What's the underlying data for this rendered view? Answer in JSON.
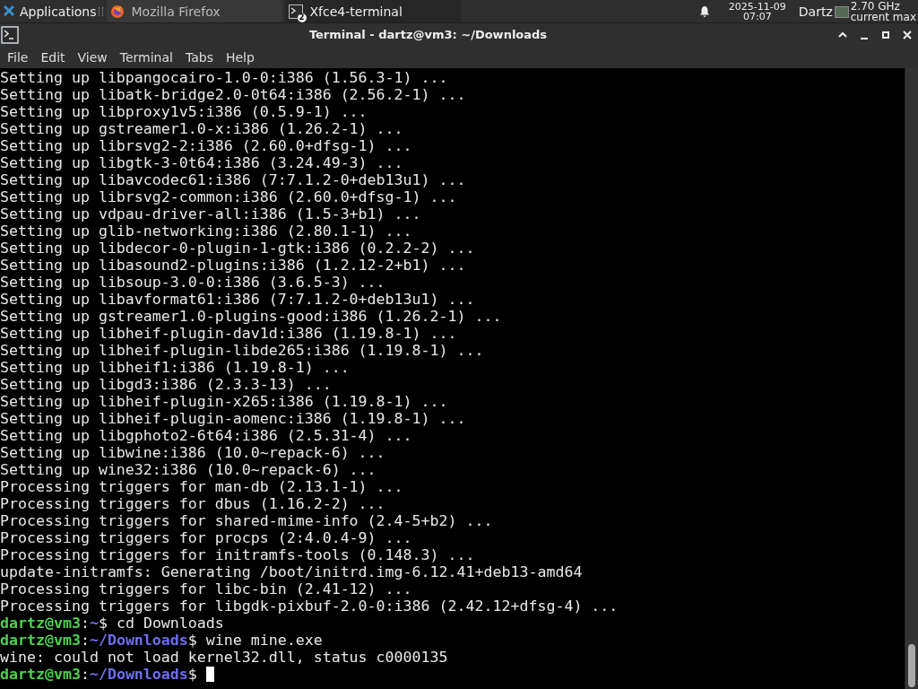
{
  "panel": {
    "applications_label": "Applications",
    "tasks": [
      {
        "label": "Mozilla Firefox",
        "kind": "browser",
        "selected": false
      },
      {
        "label": "Xfce4-terminal",
        "kind": "terminal",
        "badge": "2",
        "selected": true
      }
    ],
    "date": "2025-11-09",
    "time": "07:07",
    "user": "Dartz",
    "cpu_lines": [
      "2.70 GHz",
      "current max"
    ]
  },
  "window": {
    "title": "Terminal - dartz@vm3: ~/Downloads"
  },
  "menu": [
    "File",
    "Edit",
    "View",
    "Terminal",
    "Tabs",
    "Help"
  ],
  "terminal": {
    "lines": [
      {
        "kind": "output",
        "text": "Setting up libpangocairo-1.0-0:i386 (1.56.3-1) ..."
      },
      {
        "kind": "output",
        "text": "Setting up libatk-bridge2.0-0t64:i386 (2.56.2-1) ..."
      },
      {
        "kind": "output",
        "text": "Setting up libproxy1v5:i386 (0.5.9-1) ..."
      },
      {
        "kind": "output",
        "text": "Setting up gstreamer1.0-x:i386 (1.26.2-1) ..."
      },
      {
        "kind": "output",
        "text": "Setting up librsvg2-2:i386 (2.60.0+dfsg-1) ..."
      },
      {
        "kind": "output",
        "text": "Setting up libgtk-3-0t64:i386 (3.24.49-3) ..."
      },
      {
        "kind": "output",
        "text": "Setting up libavcodec61:i386 (7:7.1.2-0+deb13u1) ..."
      },
      {
        "kind": "output",
        "text": "Setting up librsvg2-common:i386 (2.60.0+dfsg-1) ..."
      },
      {
        "kind": "output",
        "text": "Setting up vdpau-driver-all:i386 (1.5-3+b1) ..."
      },
      {
        "kind": "output",
        "text": "Setting up glib-networking:i386 (2.80.1-1) ..."
      },
      {
        "kind": "output",
        "text": "Setting up libdecor-0-plugin-1-gtk:i386 (0.2.2-2) ..."
      },
      {
        "kind": "output",
        "text": "Setting up libasound2-plugins:i386 (1.2.12-2+b1) ..."
      },
      {
        "kind": "output",
        "text": "Setting up libsoup-3.0-0:i386 (3.6.5-3) ..."
      },
      {
        "kind": "output",
        "text": "Setting up libavformat61:i386 (7:7.1.2-0+deb13u1) ..."
      },
      {
        "kind": "output",
        "text": "Setting up gstreamer1.0-plugins-good:i386 (1.26.2-1) ..."
      },
      {
        "kind": "output",
        "text": "Setting up libheif-plugin-dav1d:i386 (1.19.8-1) ..."
      },
      {
        "kind": "output",
        "text": "Setting up libheif-plugin-libde265:i386 (1.19.8-1) ..."
      },
      {
        "kind": "output",
        "text": "Setting up libheif1:i386 (1.19.8-1) ..."
      },
      {
        "kind": "output",
        "text": "Setting up libgd3:i386 (2.3.3-13) ..."
      },
      {
        "kind": "output",
        "text": "Setting up libheif-plugin-x265:i386 (1.19.8-1) ..."
      },
      {
        "kind": "output",
        "text": "Setting up libheif-plugin-aomenc:i386 (1.19.8-1) ..."
      },
      {
        "kind": "output",
        "text": "Setting up libgphoto2-6t64:i386 (2.5.31-4) ..."
      },
      {
        "kind": "output",
        "text": "Setting up libwine:i386 (10.0~repack-6) ..."
      },
      {
        "kind": "output",
        "text": "Setting up wine32:i386 (10.0~repack-6) ..."
      },
      {
        "kind": "output",
        "text": "Processing triggers for man-db (2.13.1-1) ..."
      },
      {
        "kind": "output",
        "text": "Processing triggers for dbus (1.16.2-2) ..."
      },
      {
        "kind": "output",
        "text": "Processing triggers for shared-mime-info (2.4-5+b2) ..."
      },
      {
        "kind": "output",
        "text": "Processing triggers for procps (2:4.0.4-9) ..."
      },
      {
        "kind": "output",
        "text": "Processing triggers for initramfs-tools (0.148.3) ..."
      },
      {
        "kind": "output",
        "text": "update-initramfs: Generating /boot/initrd.img-6.12.41+deb13-amd64"
      },
      {
        "kind": "output",
        "text": "Processing triggers for libc-bin (2.41-12) ..."
      },
      {
        "kind": "output",
        "text": "Processing triggers for libgdk-pixbuf-2.0-0:i386 (2.42.12+dfsg-4) ..."
      },
      {
        "kind": "prompt",
        "user": "dartz@vm3",
        "sep": ":",
        "path": "~",
        "sign": "$",
        "command": "cd Downloads"
      },
      {
        "kind": "prompt",
        "user": "dartz@vm3",
        "sep": ":",
        "path": "~/Downloads",
        "sign": "$",
        "command": "wine mine.exe"
      },
      {
        "kind": "output",
        "text": "wine: could not load kernel32.dll, status c0000135"
      },
      {
        "kind": "prompt",
        "user": "dartz@vm3",
        "sep": ":",
        "path": "~/Downloads",
        "sign": "$",
        "cursor": true
      }
    ]
  }
}
